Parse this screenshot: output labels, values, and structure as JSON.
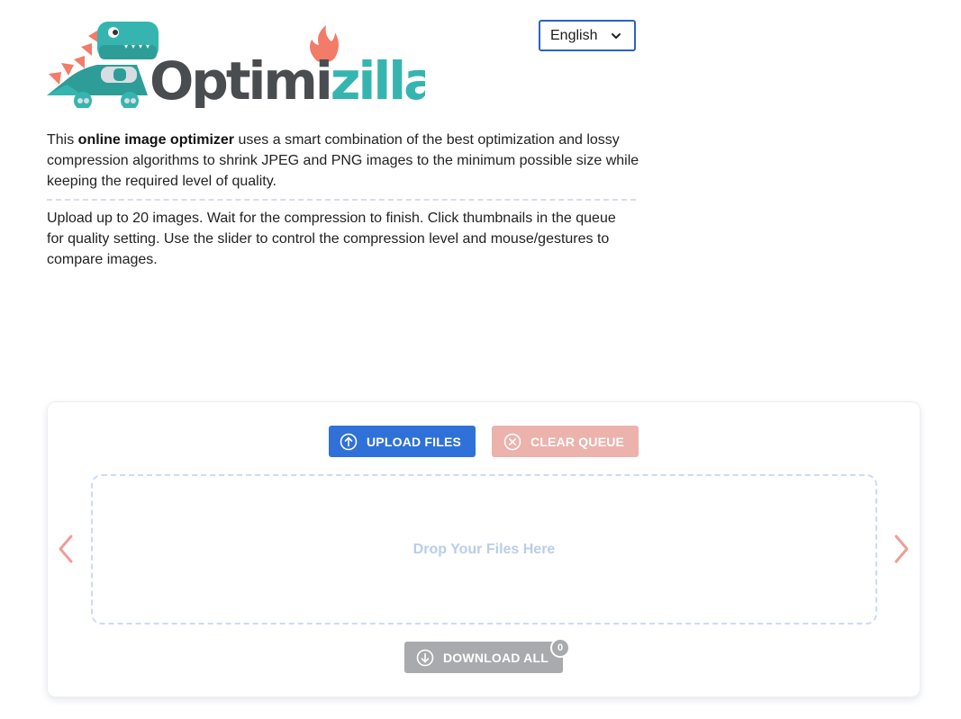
{
  "brand": {
    "logo_text_dark": "Optimi",
    "logo_text_teal": "zilla",
    "colors": {
      "teal": "#36b5b0",
      "dark": "#4a4d50",
      "coral": "#f27b6a",
      "dino": "#2e9d98"
    }
  },
  "language_select": {
    "selected": "English",
    "icon": "chevron-down-icon"
  },
  "intro": {
    "prefix": "This ",
    "bold": "online image optimizer",
    "suffix": " uses a smart combination of the best optimization and lossy compression algorithms to shrink JPEG and PNG images to the minimum possible size while keeping the required level of quality."
  },
  "instructions": "Upload up to 20 images. Wait for the compression to finish. Click thumbnails in the queue for quality setting. Use the slider to control the compression level and mouse/gestures to compare images.",
  "uploader": {
    "upload_label": "UPLOAD FILES",
    "upload_icon": "arrow-up-circle-icon",
    "clear_label": "CLEAR QUEUE",
    "clear_icon": "x-circle-icon",
    "drop_text": "Drop Your Files Here",
    "download_label": "DOWNLOAD ALL",
    "download_icon": "arrow-down-circle-icon",
    "download_count": "0",
    "colors": {
      "upload": "#2f71d8",
      "clear": "#ecb2ac",
      "download": "#a9aaad",
      "arrows": "#ec9f97"
    }
  }
}
